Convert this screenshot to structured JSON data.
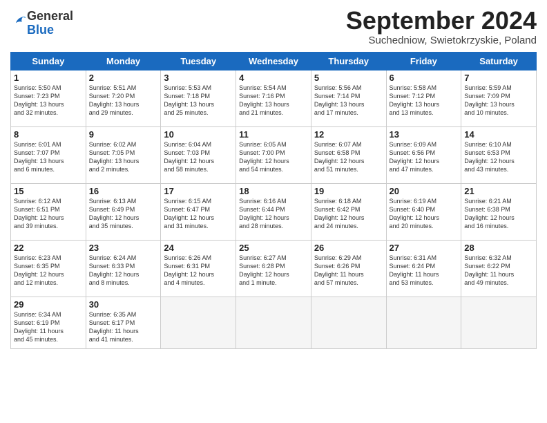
{
  "header": {
    "logo": {
      "general": "General",
      "blue": "Blue"
    },
    "title": "September 2024",
    "location": "Suchedniow, Swietokrzyskie, Poland"
  },
  "weekdays": [
    "Sunday",
    "Monday",
    "Tuesday",
    "Wednesday",
    "Thursday",
    "Friday",
    "Saturday"
  ],
  "weeks": [
    [
      {
        "day": "1",
        "info": "Sunrise: 5:50 AM\nSunset: 7:23 PM\nDaylight: 13 hours\nand 32 minutes."
      },
      {
        "day": "2",
        "info": "Sunrise: 5:51 AM\nSunset: 7:20 PM\nDaylight: 13 hours\nand 29 minutes."
      },
      {
        "day": "3",
        "info": "Sunrise: 5:53 AM\nSunset: 7:18 PM\nDaylight: 13 hours\nand 25 minutes."
      },
      {
        "day": "4",
        "info": "Sunrise: 5:54 AM\nSunset: 7:16 PM\nDaylight: 13 hours\nand 21 minutes."
      },
      {
        "day": "5",
        "info": "Sunrise: 5:56 AM\nSunset: 7:14 PM\nDaylight: 13 hours\nand 17 minutes."
      },
      {
        "day": "6",
        "info": "Sunrise: 5:58 AM\nSunset: 7:12 PM\nDaylight: 13 hours\nand 13 minutes."
      },
      {
        "day": "7",
        "info": "Sunrise: 5:59 AM\nSunset: 7:09 PM\nDaylight: 13 hours\nand 10 minutes."
      }
    ],
    [
      {
        "day": "8",
        "info": "Sunrise: 6:01 AM\nSunset: 7:07 PM\nDaylight: 13 hours\nand 6 minutes."
      },
      {
        "day": "9",
        "info": "Sunrise: 6:02 AM\nSunset: 7:05 PM\nDaylight: 13 hours\nand 2 minutes."
      },
      {
        "day": "10",
        "info": "Sunrise: 6:04 AM\nSunset: 7:03 PM\nDaylight: 12 hours\nand 58 minutes."
      },
      {
        "day": "11",
        "info": "Sunrise: 6:05 AM\nSunset: 7:00 PM\nDaylight: 12 hours\nand 54 minutes."
      },
      {
        "day": "12",
        "info": "Sunrise: 6:07 AM\nSunset: 6:58 PM\nDaylight: 12 hours\nand 51 minutes."
      },
      {
        "day": "13",
        "info": "Sunrise: 6:09 AM\nSunset: 6:56 PM\nDaylight: 12 hours\nand 47 minutes."
      },
      {
        "day": "14",
        "info": "Sunrise: 6:10 AM\nSunset: 6:53 PM\nDaylight: 12 hours\nand 43 minutes."
      }
    ],
    [
      {
        "day": "15",
        "info": "Sunrise: 6:12 AM\nSunset: 6:51 PM\nDaylight: 12 hours\nand 39 minutes."
      },
      {
        "day": "16",
        "info": "Sunrise: 6:13 AM\nSunset: 6:49 PM\nDaylight: 12 hours\nand 35 minutes."
      },
      {
        "day": "17",
        "info": "Sunrise: 6:15 AM\nSunset: 6:47 PM\nDaylight: 12 hours\nand 31 minutes."
      },
      {
        "day": "18",
        "info": "Sunrise: 6:16 AM\nSunset: 6:44 PM\nDaylight: 12 hours\nand 28 minutes."
      },
      {
        "day": "19",
        "info": "Sunrise: 6:18 AM\nSunset: 6:42 PM\nDaylight: 12 hours\nand 24 minutes."
      },
      {
        "day": "20",
        "info": "Sunrise: 6:19 AM\nSunset: 6:40 PM\nDaylight: 12 hours\nand 20 minutes."
      },
      {
        "day": "21",
        "info": "Sunrise: 6:21 AM\nSunset: 6:38 PM\nDaylight: 12 hours\nand 16 minutes."
      }
    ],
    [
      {
        "day": "22",
        "info": "Sunrise: 6:23 AM\nSunset: 6:35 PM\nDaylight: 12 hours\nand 12 minutes."
      },
      {
        "day": "23",
        "info": "Sunrise: 6:24 AM\nSunset: 6:33 PM\nDaylight: 12 hours\nand 8 minutes."
      },
      {
        "day": "24",
        "info": "Sunrise: 6:26 AM\nSunset: 6:31 PM\nDaylight: 12 hours\nand 4 minutes."
      },
      {
        "day": "25",
        "info": "Sunrise: 6:27 AM\nSunset: 6:28 PM\nDaylight: 12 hours\nand 1 minute."
      },
      {
        "day": "26",
        "info": "Sunrise: 6:29 AM\nSunset: 6:26 PM\nDaylight: 11 hours\nand 57 minutes."
      },
      {
        "day": "27",
        "info": "Sunrise: 6:31 AM\nSunset: 6:24 PM\nDaylight: 11 hours\nand 53 minutes."
      },
      {
        "day": "28",
        "info": "Sunrise: 6:32 AM\nSunset: 6:22 PM\nDaylight: 11 hours\nand 49 minutes."
      }
    ],
    [
      {
        "day": "29",
        "info": "Sunrise: 6:34 AM\nSunset: 6:19 PM\nDaylight: 11 hours\nand 45 minutes."
      },
      {
        "day": "30",
        "info": "Sunrise: 6:35 AM\nSunset: 6:17 PM\nDaylight: 11 hours\nand 41 minutes."
      },
      null,
      null,
      null,
      null,
      null
    ]
  ]
}
